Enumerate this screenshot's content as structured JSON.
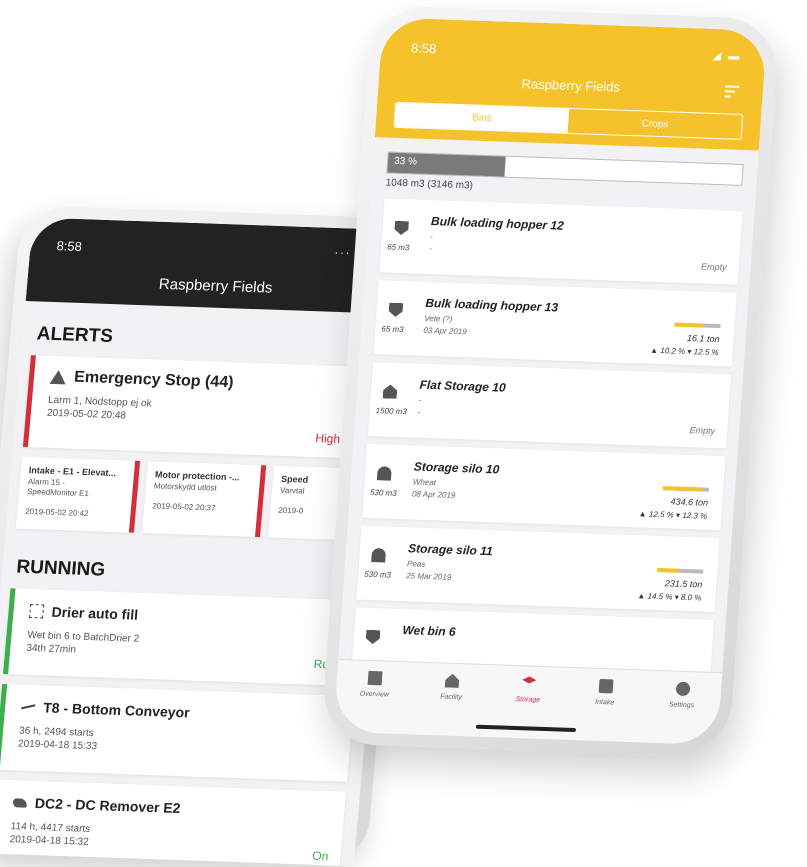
{
  "left_phone": {
    "status_time": "8:58",
    "status_icons": "···  ◢ ▬",
    "title": "Raspberry Fields",
    "alerts_header": "ALERTS",
    "main_alert": {
      "title": "Emergency Stop (44)",
      "line1": "Larm 1, Nödstopp ej ok",
      "line2": "2019-05-02 20:48",
      "priority": "High Prio"
    },
    "mini_alerts": [
      {
        "title": "Intake - E1 - Elevat...",
        "line1": "Alarm 15 -",
        "line2": "SpeedMonitor E1",
        "date": "2019-05-02 20:42"
      },
      {
        "title": "Motor protection -...",
        "line1": "Motorskydd utlöst",
        "line2": "",
        "date": "2019-05-02 20:37"
      },
      {
        "title": "Speed",
        "line1": "Varvtal",
        "line2": "",
        "date": "2019-0"
      }
    ],
    "running_header": "RUNNING",
    "running": [
      {
        "icon": "dryer-icon",
        "title": "Drier auto fill",
        "line1": "Wet bin 6 to BatchDrier 2",
        "line2": "34th 27min",
        "state": "Runni"
      },
      {
        "icon": "conveyor-icon",
        "title": "T8 - Bottom Conveyor",
        "line1": "36 h, 2494 starts",
        "line2": "2019-04-18 15:33",
        "state": ""
      },
      {
        "icon": "remover-icon",
        "title": "DC2 - DC Remover E2",
        "line1": "114 h, 4417 starts",
        "line2": "2019-04-18 15:32",
        "state": "On"
      }
    ]
  },
  "right_phone": {
    "status_time": "8:58",
    "status_icons": "◢ ▬",
    "title": "Raspberry Fields",
    "segments": [
      "Bins",
      "Crops"
    ],
    "active_segment": 0,
    "capacity": {
      "percent_label": "33 %",
      "fill_fraction": 0.33,
      "summary": "1048 m3 (3146 m3)"
    },
    "bins": [
      {
        "icon": "hopper",
        "name": "Bulk loading hopper 12",
        "volume": "65 m3",
        "crop": "-",
        "date": "-",
        "empty": "Empty",
        "level": null,
        "tons": "",
        "measure": ""
      },
      {
        "icon": "hopper",
        "name": "Bulk loading hopper 13",
        "volume": "65 m3",
        "crop": "Vete (?)",
        "date": "03 Apr 2019",
        "empty": "",
        "level": 0.6,
        "tons": "16.1 ton",
        "measure": "▲ 10.2 %  ▾ 12.5 %"
      },
      {
        "icon": "flat",
        "name": "Flat Storage 10",
        "volume": "1500 m3",
        "crop": "-",
        "date": "-",
        "empty": "Empty",
        "level": null,
        "tons": "",
        "measure": ""
      },
      {
        "icon": "silo",
        "name": "Storage silo 10",
        "volume": "530 m3",
        "crop": "Wheat",
        "date": "08 Apr 2019",
        "empty": "",
        "level": 0.85,
        "tons": "434.6 ton",
        "measure": "▲ 12.5 %  ▾ 12.3 %"
      },
      {
        "icon": "silo",
        "name": "Storage silo 11",
        "volume": "530 m3",
        "crop": "Peas",
        "date": "25 Mar 2019",
        "empty": "",
        "level": 0.45,
        "tons": "231.5 ton",
        "measure": "▲ 14.5 %  ▾ 8.0 %"
      },
      {
        "icon": "hopper",
        "name": "Wet bin 6",
        "volume": "",
        "crop": "",
        "date": "",
        "empty": "",
        "level": null,
        "tons": "",
        "measure": ""
      }
    ],
    "tabs": [
      "Overview",
      "Facility",
      "Storage",
      "Intake",
      "Settings"
    ],
    "active_tab": 2
  },
  "colors": {
    "yellow": "#f6c22c",
    "alert_red": "#d32f3a",
    "running_green": "#3cae4d",
    "dark_header": "#222222"
  }
}
